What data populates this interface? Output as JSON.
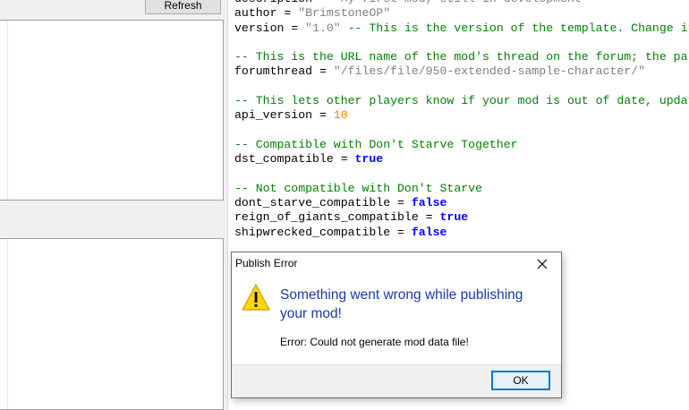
{
  "toolbar": {
    "refresh_label": "Refresh"
  },
  "editor": {
    "lines": [
      [
        {
          "t": "description = ",
          "c": "p"
        },
        {
          "t": "\"My first mod, still in development\"",
          "c": "s"
        }
      ],
      [
        {
          "t": "author = ",
          "c": "p"
        },
        {
          "t": "\"BrimstoneOP\"",
          "c": "s"
        }
      ],
      [
        {
          "t": "version = ",
          "c": "p"
        },
        {
          "t": "\"1.0\"",
          "c": "s"
        },
        {
          "t": " -- This is the version of the template. Change it to your own number.",
          "c": "c"
        }
      ],
      [],
      [
        {
          "t": "-- This is the URL name of the mod's thread on the forum; the part after the ? and before the first & in the url",
          "c": "c"
        }
      ],
      [
        {
          "t": "forumthread = ",
          "c": "p"
        },
        {
          "t": "\"/files/file/950-extended-sample-character/\"",
          "c": "s"
        }
      ],
      [],
      [
        {
          "t": "-- This lets other players know if your mod is out of date, update it to match the current version in the game",
          "c": "c"
        }
      ],
      [
        {
          "t": "api_version = ",
          "c": "p"
        },
        {
          "t": "10",
          "c": "n"
        }
      ],
      [],
      [
        {
          "t": "-- Compatible with Don't Starve Together",
          "c": "c"
        }
      ],
      [
        {
          "t": "dst_compatible = ",
          "c": "p"
        },
        {
          "t": "true",
          "c": "k"
        }
      ],
      [],
      [
        {
          "t": "-- Not compatible with Don't Starve",
          "c": "c"
        }
      ],
      [
        {
          "t": "dont_starve_compatible = ",
          "c": "p"
        },
        {
          "t": "false",
          "c": "k"
        }
      ],
      [
        {
          "t": "reign_of_giants_compatible = ",
          "c": "p"
        },
        {
          "t": "true",
          "c": "k"
        }
      ],
      [
        {
          "t": "shipwrecked_compatible = ",
          "c": "p"
        },
        {
          "t": "false",
          "c": "k"
        }
      ]
    ],
    "colors": {
      "comment": "#008000",
      "string": "#808080",
      "number": "#ff8000",
      "keyword": "#0000ff",
      "plain": "#000000"
    }
  },
  "dialog": {
    "title": "Publish Error",
    "close_icon": "close-icon",
    "warning_icon": "warning-icon",
    "main_instruction": "Something went wrong while publishing your mod!",
    "content": "Error: Could not generate mod data file!",
    "ok_label": "OK",
    "colors": {
      "instruction": "#1a3aa8",
      "ok_border": "#0078d7",
      "warning_fill": "#ffd800"
    }
  }
}
